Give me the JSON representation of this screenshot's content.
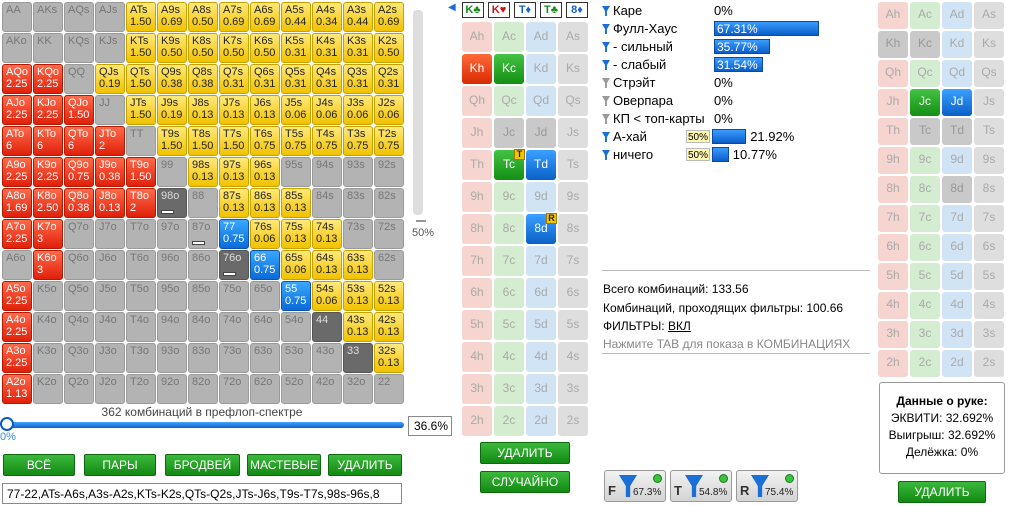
{
  "matrix": {
    "rows": [
      [
        {
          "t": "AA",
          "s": "c-pair"
        },
        {
          "t": "AKs",
          "s": "c-suit"
        },
        {
          "t": "AQs",
          "s": "c-suit"
        },
        {
          "t": "AJs",
          "s": "c-suit"
        },
        {
          "t": "ATs",
          "w": "1.50",
          "s": "yel"
        },
        {
          "t": "A9s",
          "w": "0.69",
          "s": "yel"
        },
        {
          "t": "A8s",
          "w": "0.50",
          "s": "yel"
        },
        {
          "t": "A7s",
          "w": "0.69",
          "s": "yel"
        },
        {
          "t": "A6s",
          "w": "0.69",
          "s": "yel"
        },
        {
          "t": "A5s",
          "w": "0.44",
          "s": "yel"
        },
        {
          "t": "A4s",
          "w": "0.34",
          "s": "yel"
        },
        {
          "t": "A3s",
          "w": "0.44",
          "s": "yel"
        },
        {
          "t": "A2s",
          "w": "0.69",
          "s": "yel"
        }
      ],
      [
        {
          "t": "AKo",
          "s": "c-off"
        },
        {
          "t": "KK",
          "s": "c-pair"
        },
        {
          "t": "KQs",
          "s": "c-suit"
        },
        {
          "t": "KJs",
          "s": "c-suit"
        },
        {
          "t": "KTs",
          "w": "1.50",
          "s": "yel"
        },
        {
          "t": "K9s",
          "w": "0.50",
          "s": "yel"
        },
        {
          "t": "K8s",
          "w": "0.50",
          "s": "yel"
        },
        {
          "t": "K7s",
          "w": "0.50",
          "s": "yel"
        },
        {
          "t": "K6s",
          "w": "0.50",
          "s": "yel"
        },
        {
          "t": "K5s",
          "w": "0.31",
          "s": "yel"
        },
        {
          "t": "K4s",
          "w": "0.31",
          "s": "yel"
        },
        {
          "t": "K3s",
          "w": "0.31",
          "s": "yel"
        },
        {
          "t": "K2s",
          "w": "0.50",
          "s": "yel"
        }
      ],
      [
        {
          "t": "AQo",
          "w": "2.25",
          "s": "red"
        },
        {
          "t": "KQo",
          "w": "2.25",
          "s": "red"
        },
        {
          "t": "QQ",
          "s": "c-pair"
        },
        {
          "t": "QJs",
          "w": "0.19",
          "s": "yel"
        },
        {
          "t": "QTs",
          "w": "1.50",
          "s": "yel"
        },
        {
          "t": "Q9s",
          "w": "0.38",
          "s": "yel"
        },
        {
          "t": "Q8s",
          "w": "0.38",
          "s": "yel"
        },
        {
          "t": "Q7s",
          "w": "0.31",
          "s": "yel"
        },
        {
          "t": "Q6s",
          "w": "0.31",
          "s": "yel"
        },
        {
          "t": "Q5s",
          "w": "0.31",
          "s": "yel"
        },
        {
          "t": "Q4s",
          "w": "0.31",
          "s": "yel"
        },
        {
          "t": "Q3s",
          "w": "0.31",
          "s": "yel"
        },
        {
          "t": "Q2s",
          "w": "0.31",
          "s": "yel"
        }
      ],
      [
        {
          "t": "AJo",
          "w": "2.25",
          "s": "red"
        },
        {
          "t": "KJo",
          "w": "2.25",
          "s": "red"
        },
        {
          "t": "QJo",
          "w": "1.50",
          "s": "red"
        },
        {
          "t": "JJ",
          "s": "c-pair"
        },
        {
          "t": "JTs",
          "w": "1.50",
          "s": "yel"
        },
        {
          "t": "J9s",
          "w": "0.19",
          "s": "yel"
        },
        {
          "t": "J8s",
          "w": "0.13",
          "s": "yel"
        },
        {
          "t": "J7s",
          "w": "0.13",
          "s": "yel"
        },
        {
          "t": "J6s",
          "w": "0.13",
          "s": "yel"
        },
        {
          "t": "J5s",
          "w": "0.06",
          "s": "yel"
        },
        {
          "t": "J4s",
          "w": "0.06",
          "s": "yel"
        },
        {
          "t": "J3s",
          "w": "0.06",
          "s": "yel"
        },
        {
          "t": "J2s",
          "w": "0.06",
          "s": "yel"
        }
      ],
      [
        {
          "t": "ATo",
          "w": "6",
          "s": "red"
        },
        {
          "t": "KTo",
          "w": "6",
          "s": "red"
        },
        {
          "t": "QTo",
          "w": "6",
          "s": "red"
        },
        {
          "t": "JTo",
          "w": "2",
          "s": "red"
        },
        {
          "t": "TT",
          "s": "c-pair"
        },
        {
          "t": "T9s",
          "w": "1.50",
          "s": "yel"
        },
        {
          "t": "T8s",
          "w": "1.50",
          "s": "yel"
        },
        {
          "t": "T7s",
          "w": "1.50",
          "s": "yel"
        },
        {
          "t": "T6s",
          "w": "0.75",
          "s": "yel"
        },
        {
          "t": "T5s",
          "w": "0.75",
          "s": "yel"
        },
        {
          "t": "T4s",
          "w": "0.75",
          "s": "yel"
        },
        {
          "t": "T3s",
          "w": "0.75",
          "s": "yel"
        },
        {
          "t": "T2s",
          "w": "0.75",
          "s": "yel"
        }
      ],
      [
        {
          "t": "A9o",
          "w": "2.25",
          "s": "red"
        },
        {
          "t": "K9o",
          "w": "2.25",
          "s": "red"
        },
        {
          "t": "Q9o",
          "w": "0.75",
          "s": "red"
        },
        {
          "t": "J9o",
          "w": "0.38",
          "s": "red"
        },
        {
          "t": "T9o",
          "w": "1.50",
          "s": "red"
        },
        {
          "t": "99",
          "s": "c-pair"
        },
        {
          "t": "98s",
          "w": "0.13",
          "s": "yel"
        },
        {
          "t": "97s",
          "w": "0.13",
          "s": "yel"
        },
        {
          "t": "96s",
          "w": "0.13",
          "s": "yel"
        },
        {
          "t": "95s",
          "s": "c-suit"
        },
        {
          "t": "94s",
          "s": "c-suit"
        },
        {
          "t": "93s",
          "s": "c-suit"
        },
        {
          "t": "92s",
          "s": "c-suit"
        }
      ],
      [
        {
          "t": "A8o",
          "w": "1.69",
          "s": "red"
        },
        {
          "t": "K8o",
          "w": "2.50",
          "s": "red"
        },
        {
          "t": "Q8o",
          "w": "0.38",
          "s": "red"
        },
        {
          "t": "J8o",
          "w": "0.13",
          "s": "red"
        },
        {
          "t": "T8o",
          "w": "2",
          "s": "red"
        },
        {
          "t": "98o",
          "s": "dark",
          "bar": true
        },
        {
          "t": "88",
          "s": "c-pair"
        },
        {
          "t": "87s",
          "w": "0.13",
          "s": "yel"
        },
        {
          "t": "86s",
          "w": "0.13",
          "s": "yel"
        },
        {
          "t": "85s",
          "w": "0.13",
          "s": "yel"
        },
        {
          "t": "84s",
          "s": "c-suit"
        },
        {
          "t": "83s",
          "s": "c-suit"
        },
        {
          "t": "82s",
          "s": "c-suit"
        }
      ],
      [
        {
          "t": "A7o",
          "w": "2.25",
          "s": "red"
        },
        {
          "t": "K7o",
          "w": "3",
          "s": "red"
        },
        {
          "t": "Q7o",
          "s": "c-off"
        },
        {
          "t": "J7o",
          "s": "c-off"
        },
        {
          "t": "T7o",
          "s": "c-off"
        },
        {
          "t": "97o",
          "s": "c-off"
        },
        {
          "t": "87o",
          "s": "c-off",
          "bar": true
        },
        {
          "t": "77",
          "w": "0.75",
          "s": "blu"
        },
        {
          "t": "76s",
          "w": "0.06",
          "s": "yel"
        },
        {
          "t": "75s",
          "w": "0.13",
          "s": "yel"
        },
        {
          "t": "74s",
          "w": "0.13",
          "s": "yel"
        },
        {
          "t": "73s",
          "s": "c-suit"
        },
        {
          "t": "72s",
          "s": "c-suit"
        }
      ],
      [
        {
          "t": "A6o",
          "s": "c-off"
        },
        {
          "t": "K6o",
          "w": "3",
          "s": "red"
        },
        {
          "t": "Q6o",
          "s": "c-off"
        },
        {
          "t": "J6o",
          "s": "c-off"
        },
        {
          "t": "T6o",
          "s": "c-off"
        },
        {
          "t": "96o",
          "s": "c-off"
        },
        {
          "t": "86o",
          "s": "c-off"
        },
        {
          "t": "76o",
          "s": "dark",
          "bar": true
        },
        {
          "t": "66",
          "w": "0.75",
          "s": "blu"
        },
        {
          "t": "65s",
          "w": "0.06",
          "s": "yel"
        },
        {
          "t": "64s",
          "w": "0.13",
          "s": "yel"
        },
        {
          "t": "63s",
          "w": "0.13",
          "s": "yel"
        },
        {
          "t": "62s",
          "s": "c-suit"
        }
      ],
      [
        {
          "t": "A5o",
          "w": "2.25",
          "s": "red"
        },
        {
          "t": "K5o",
          "s": "c-off"
        },
        {
          "t": "Q5o",
          "s": "c-off"
        },
        {
          "t": "J5o",
          "s": "c-off"
        },
        {
          "t": "T5o",
          "s": "c-off"
        },
        {
          "t": "95o",
          "s": "c-off"
        },
        {
          "t": "85o",
          "s": "c-off"
        },
        {
          "t": "75o",
          "s": "c-off"
        },
        {
          "t": "65o",
          "s": "c-off"
        },
        {
          "t": "55",
          "w": "0.75",
          "s": "blu"
        },
        {
          "t": "54s",
          "w": "0.06",
          "s": "yel"
        },
        {
          "t": "53s",
          "w": "0.13",
          "s": "yel"
        },
        {
          "t": "52s",
          "w": "0.13",
          "s": "yel"
        }
      ],
      [
        {
          "t": "A4o",
          "w": "2.25",
          "s": "red"
        },
        {
          "t": "K4o",
          "s": "c-off"
        },
        {
          "t": "Q4o",
          "s": "c-off"
        },
        {
          "t": "J4o",
          "s": "c-off"
        },
        {
          "t": "T4o",
          "s": "c-off"
        },
        {
          "t": "94o",
          "s": "c-off"
        },
        {
          "t": "84o",
          "s": "c-off"
        },
        {
          "t": "74o",
          "s": "c-off"
        },
        {
          "t": "64o",
          "s": "c-off"
        },
        {
          "t": "54o",
          "s": "c-off"
        },
        {
          "t": "44",
          "s": "dark"
        },
        {
          "t": "43s",
          "w": "0.13",
          "s": "yel"
        },
        {
          "t": "42s",
          "w": "0.13",
          "s": "yel"
        }
      ],
      [
        {
          "t": "A3o",
          "w": "2.25",
          "s": "red"
        },
        {
          "t": "K3o",
          "s": "c-off"
        },
        {
          "t": "Q3o",
          "s": "c-off"
        },
        {
          "t": "J3o",
          "s": "c-off"
        },
        {
          "t": "T3o",
          "s": "c-off"
        },
        {
          "t": "93o",
          "s": "c-off"
        },
        {
          "t": "83o",
          "s": "c-off"
        },
        {
          "t": "73o",
          "s": "c-off"
        },
        {
          "t": "63o",
          "s": "c-off"
        },
        {
          "t": "53o",
          "s": "c-off"
        },
        {
          "t": "43o",
          "s": "c-off"
        },
        {
          "t": "33",
          "s": "dark"
        },
        {
          "t": "32s",
          "w": "0.13",
          "s": "yel"
        }
      ],
      [
        {
          "t": "A2o",
          "w": "1.13",
          "s": "red"
        },
        {
          "t": "K2o",
          "s": "c-off"
        },
        {
          "t": "Q2o",
          "s": "c-off"
        },
        {
          "t": "J2o",
          "s": "c-off"
        },
        {
          "t": "T2o",
          "s": "c-off"
        },
        {
          "t": "92o",
          "s": "c-off"
        },
        {
          "t": "82o",
          "s": "c-off"
        },
        {
          "t": "72o",
          "s": "c-off"
        },
        {
          "t": "62o",
          "s": "c-off"
        },
        {
          "t": "52o",
          "s": "c-off"
        },
        {
          "t": "42o",
          "s": "c-off"
        },
        {
          "t": "32o",
          "s": "c-off"
        },
        {
          "t": "22",
          "s": "c-pair"
        }
      ]
    ]
  },
  "vslider": {
    "label": "50%",
    "level": 0.5
  },
  "combo_label": "362 комбинаций в префлоп-спектре",
  "hslider": {
    "value_label": "0%",
    "level": 0.0
  },
  "pct_box": "36.6%",
  "buttons": {
    "all": "ВСЁ",
    "pairs": "ПАРЫ",
    "broadway": "БРОДВЕЙ",
    "suited": "МАСТЕВЫЕ",
    "delete": "УДАЛИТЬ"
  },
  "range_text": "77-22,ATs-A6s,A3s-A2s,KTs-K2s,QTs-Q2s,JTs-J6s,T9s-T7s,98s-96s,8",
  "board": {
    "cards": [
      {
        "t": "K♣",
        "c": "#1a8a1a"
      },
      {
        "t": "K♥",
        "c": "#d01010"
      },
      {
        "t": "T♦",
        "c": "#1a60d0"
      },
      {
        "t": "T♣",
        "c": "#1a8a1a"
      },
      {
        "t": "8♦",
        "c": "#1a60d0"
      }
    ],
    "marker": "◀"
  },
  "board_grid": [
    [
      "Ah",
      "Ac",
      "Ad",
      "As"
    ],
    [
      "Kh",
      "Kc",
      "Kd",
      "Ks"
    ],
    [
      "Qh",
      "Qc",
      "Qd",
      "Qs"
    ],
    [
      "Jh",
      "Jc",
      "Jd",
      "Js"
    ],
    [
      "Th",
      "Tc",
      "Td",
      "Ts"
    ],
    [
      "9h",
      "9c",
      "9d",
      "9s"
    ],
    [
      "8h",
      "8c",
      "8d",
      "8s"
    ],
    [
      "7h",
      "7c",
      "7d",
      "7s"
    ],
    [
      "6h",
      "6c",
      "6d",
      "6s"
    ],
    [
      "5h",
      "5c",
      "5d",
      "5s"
    ],
    [
      "4h",
      "4c",
      "4d",
      "4s"
    ],
    [
      "3h",
      "3c",
      "3d",
      "3s"
    ],
    [
      "2h",
      "2c",
      "2d",
      "2s"
    ]
  ],
  "board_tags": {
    "T": "T",
    "R": "R"
  },
  "board_buttons": {
    "delete": "УДАЛИТЬ",
    "random": "СЛУЧАЙНО"
  },
  "stats": [
    {
      "label": "Каре",
      "value": "0%",
      "filter": "blue"
    },
    {
      "label": "Фулл-Хаус",
      "value": "67.31%",
      "bar": 0.6731,
      "filter": "blue"
    },
    {
      "label": "- сильный",
      "value": "35.77%",
      "bar": 0.3577,
      "filter": "blue"
    },
    {
      "label": "- слабый",
      "value": "31.54%",
      "bar": 0.3154,
      "filter": "blue"
    },
    {
      "label": "Стрэйт",
      "value": "0%",
      "filter": "gray"
    },
    {
      "label": "Оверпара",
      "value": "0%",
      "filter": "gray"
    },
    {
      "label": "КП < топ-карты",
      "value": "0%",
      "filter": "gray"
    },
    {
      "label": "А-хай",
      "value": "21.92%",
      "pct": "50%",
      "bar": 0.2192,
      "filter": "blue"
    },
    {
      "label": "ничего",
      "value": "10.77%",
      "pct": "50%",
      "bar": 0.1077,
      "filter": "blue"
    }
  ],
  "totals": {
    "total": "Всего комбинаций: 133.56",
    "passing": "Комбинаций, проходящих фильтры: 100.66",
    "filters_label": "ФИЛЬТРЫ:",
    "filters_value": "ВКЛ",
    "hint": "Нажмите TAB для показа в КОМБИНАЦИЯХ"
  },
  "filter_buttons": [
    {
      "letter": "F",
      "value": "67.3%"
    },
    {
      "letter": "T",
      "value": "54.8%"
    },
    {
      "letter": "R",
      "value": "75.4%"
    }
  ],
  "hand_grid": [
    [
      "Ah",
      "Ac",
      "Ad",
      "As"
    ],
    [
      "Kh",
      "Kc",
      "Kd",
      "Ks"
    ],
    [
      "Qh",
      "Qc",
      "Qd",
      "Qs"
    ],
    [
      "Jh",
      "Jc",
      "Jd",
      "Js"
    ],
    [
      "Th",
      "Tc",
      "Td",
      "Ts"
    ],
    [
      "9h",
      "9c",
      "9d",
      "9s"
    ],
    [
      "8h",
      "8c",
      "8d",
      "8s"
    ],
    [
      "7h",
      "7c",
      "7d",
      "7s"
    ],
    [
      "6h",
      "6c",
      "6d",
      "6s"
    ],
    [
      "5h",
      "5c",
      "5d",
      "5s"
    ],
    [
      "4h",
      "4c",
      "4d",
      "4s"
    ],
    [
      "3h",
      "3c",
      "3d",
      "3s"
    ],
    [
      "2h",
      "2c",
      "2d",
      "2s"
    ]
  ],
  "hand_data": {
    "title": "Данные о руке:",
    "equity": "ЭКВИТИ: 32.692%",
    "win": "Выигрыш: 32.692%",
    "tie": "Делёжка: 0%"
  },
  "hand_delete": "УДАЛИТЬ"
}
